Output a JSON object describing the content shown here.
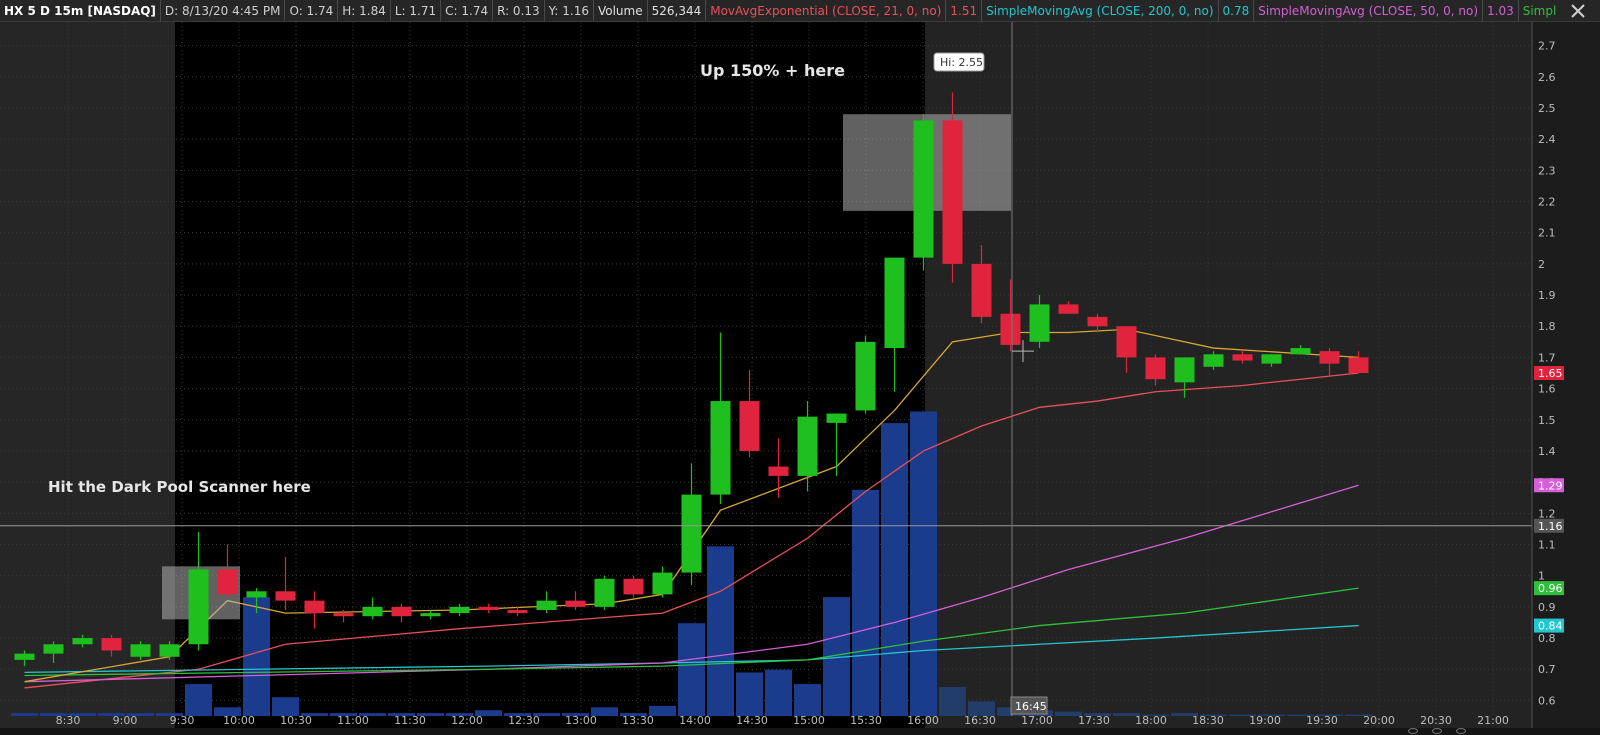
{
  "header": {
    "symbol": "HX 5 D 15m [NASDAQ]",
    "date": "D: 8/13/20 4:45 PM",
    "open": "O: 1.74",
    "high": "H: 1.84",
    "low": "L: 1.71",
    "close": "C: 1.74",
    "range": "R: 0.13",
    "y": "Y: 1.16",
    "volume_label": "Volume",
    "volume_value": "526,344",
    "studies": [
      {
        "label": "MovAvgExponential (CLOSE, 21, 0, no)",
        "value": "1.51",
        "color": "#e8505a"
      },
      {
        "label": "SimpleMovingAvg (CLOSE, 200, 0, no)",
        "value": "0.78",
        "color": "#22c6cf"
      },
      {
        "label": "SimpleMovingAvg (CLOSE, 50, 0, no)",
        "value": "1.03",
        "color": "#d45fd6"
      },
      {
        "label": "SimpleMovingAvg (CLOSE,...",
        "value": "",
        "color": "#2fbf3c"
      }
    ]
  },
  "annotations": {
    "up_text": "Up  150% + here",
    "scanner_text": "Hit the Dark Pool Scanner here",
    "hi_bubble": "Hi: 2.55",
    "crosshair_time": "16:45"
  },
  "chart_data": {
    "type": "candlestick",
    "interval": "15m",
    "ylim": [
      0.55,
      2.75
    ],
    "yticks": [
      0.6,
      0.7,
      0.8,
      0.9,
      1.0,
      1.1,
      1.2,
      1.3,
      1.4,
      1.5,
      1.6,
      1.7,
      1.8,
      1.9,
      2.0,
      2.1,
      2.2,
      2.3,
      2.4,
      2.5,
      2.6,
      2.7
    ],
    "ytick_labels": [
      "0.6",
      "0.7",
      "0.8",
      "0.9",
      "1",
      "1.1",
      "1.2",
      "1.3",
      "1.4",
      "1.5",
      "1.6",
      "1.7",
      "1.8",
      "1.9",
      "2",
      "2.1",
      "2.2",
      "2.3",
      "2.4",
      "2.5",
      "2.6",
      "2.7"
    ],
    "xticks": [
      "8:30",
      "9:00",
      "9:30",
      "10:00",
      "10:30",
      "11:00",
      "11:30",
      "12:00",
      "12:30",
      "13:00",
      "13:30",
      "14:00",
      "14:30",
      "15:00",
      "15:30",
      "16:00",
      "16:30",
      "17:00",
      "17:30",
      "18:00",
      "18:30",
      "19:00",
      "19:30",
      "20:00",
      "20:30",
      "21:00"
    ],
    "candles": [
      {
        "t": "8:15",
        "o": 0.73,
        "h": 0.76,
        "l": 0.71,
        "c": 0.75
      },
      {
        "t": "8:30",
        "o": 0.75,
        "h": 0.79,
        "l": 0.72,
        "c": 0.78
      },
      {
        "t": "8:45",
        "o": 0.78,
        "h": 0.81,
        "l": 0.77,
        "c": 0.8
      },
      {
        "t": "9:00",
        "o": 0.8,
        "h": 0.81,
        "l": 0.74,
        "c": 0.76
      },
      {
        "t": "9:15",
        "o": 0.74,
        "h": 0.79,
        "l": 0.73,
        "c": 0.78
      },
      {
        "t": "9:30",
        "o": 0.74,
        "h": 0.79,
        "l": 0.73,
        "c": 0.78
      },
      {
        "t": "9:45",
        "o": 0.78,
        "h": 1.14,
        "l": 0.76,
        "c": 1.02
      },
      {
        "t": "10:00",
        "o": 1.02,
        "h": 1.1,
        "l": 0.93,
        "c": 0.94
      },
      {
        "t": "10:15",
        "o": 0.93,
        "h": 0.96,
        "l": 0.88,
        "c": 0.95
      },
      {
        "t": "10:30",
        "o": 0.95,
        "h": 1.06,
        "l": 0.89,
        "c": 0.92
      },
      {
        "t": "10:45",
        "o": 0.92,
        "h": 0.95,
        "l": 0.83,
        "c": 0.88
      },
      {
        "t": "11:00",
        "o": 0.88,
        "h": 0.89,
        "l": 0.85,
        "c": 0.87
      },
      {
        "t": "11:15",
        "o": 0.87,
        "h": 0.93,
        "l": 0.86,
        "c": 0.9
      },
      {
        "t": "11:30",
        "o": 0.9,
        "h": 0.91,
        "l": 0.85,
        "c": 0.87
      },
      {
        "t": "11:45",
        "o": 0.87,
        "h": 0.89,
        "l": 0.86,
        "c": 0.88
      },
      {
        "t": "12:00",
        "o": 0.88,
        "h": 0.91,
        "l": 0.87,
        "c": 0.9
      },
      {
        "t": "12:15",
        "o": 0.9,
        "h": 0.91,
        "l": 0.88,
        "c": 0.89
      },
      {
        "t": "12:30",
        "o": 0.89,
        "h": 0.9,
        "l": 0.87,
        "c": 0.88
      },
      {
        "t": "12:45",
        "o": 0.89,
        "h": 0.95,
        "l": 0.88,
        "c": 0.92
      },
      {
        "t": "13:00",
        "o": 0.92,
        "h": 0.95,
        "l": 0.89,
        "c": 0.9
      },
      {
        "t": "13:15",
        "o": 0.9,
        "h": 1.0,
        "l": 0.89,
        "c": 0.99
      },
      {
        "t": "13:30",
        "o": 0.99,
        "h": 1.0,
        "l": 0.93,
        "c": 0.94
      },
      {
        "t": "13:45",
        "o": 0.94,
        "h": 1.03,
        "l": 0.93,
        "c": 1.01
      },
      {
        "t": "14:00",
        "o": 1.01,
        "h": 1.36,
        "l": 0.97,
        "c": 1.26
      },
      {
        "t": "14:15",
        "o": 1.26,
        "h": 1.78,
        "l": 1.23,
        "c": 1.56
      },
      {
        "t": "14:30",
        "o": 1.56,
        "h": 1.66,
        "l": 1.38,
        "c": 1.4
      },
      {
        "t": "14:45",
        "o": 1.35,
        "h": 1.44,
        "l": 1.25,
        "c": 1.32
      },
      {
        "t": "15:00",
        "o": 1.32,
        "h": 1.56,
        "l": 1.27,
        "c": 1.51
      },
      {
        "t": "15:15",
        "o": 1.49,
        "h": 1.52,
        "l": 1.32,
        "c": 1.52
      },
      {
        "t": "15:30",
        "o": 1.53,
        "h": 1.77,
        "l": 1.52,
        "c": 1.75
      },
      {
        "t": "15:45",
        "o": 1.73,
        "h": 1.92,
        "l": 1.59,
        "c": 2.02
      },
      {
        "t": "16:00",
        "o": 2.02,
        "h": 2.48,
        "l": 1.98,
        "c": 2.46
      },
      {
        "t": "16:15",
        "o": 2.46,
        "h": 2.55,
        "l": 1.94,
        "c": 2.0
      },
      {
        "t": "16:30",
        "o": 2.0,
        "h": 2.06,
        "l": 1.81,
        "c": 1.83
      },
      {
        "t": "16:45",
        "o": 1.84,
        "h": 1.95,
        "l": 1.72,
        "c": 1.74
      },
      {
        "t": "17:15",
        "o": 1.75,
        "h": 1.9,
        "l": 1.73,
        "c": 1.87
      },
      {
        "t": "17:30",
        "o": 1.87,
        "h": 1.88,
        "l": 1.84,
        "c": 1.84
      },
      {
        "t": "17:45",
        "o": 1.83,
        "h": 1.84,
        "l": 1.78,
        "c": 1.8
      },
      {
        "t": "18:00",
        "o": 1.8,
        "h": 1.8,
        "l": 1.65,
        "c": 1.7
      },
      {
        "t": "18:15",
        "o": 1.7,
        "h": 1.71,
        "l": 1.61,
        "c": 1.63
      },
      {
        "t": "18:30",
        "o": 1.62,
        "h": 1.7,
        "l": 1.57,
        "c": 1.7
      },
      {
        "t": "18:45",
        "o": 1.67,
        "h": 1.72,
        "l": 1.66,
        "c": 1.71
      },
      {
        "t": "19:00",
        "o": 1.71,
        "h": 1.72,
        "l": 1.68,
        "c": 1.69
      },
      {
        "t": "19:15",
        "o": 1.68,
        "h": 1.71,
        "l": 1.67,
        "c": 1.71
      },
      {
        "t": "19:30",
        "o": 1.71,
        "h": 1.74,
        "l": 1.71,
        "c": 1.73
      },
      {
        "t": "19:45",
        "o": 1.72,
        "h": 1.73,
        "l": 1.64,
        "c": 1.68
      },
      {
        "t": "20:00",
        "o": 1.7,
        "h": 1.72,
        "l": 1.65,
        "c": 1.65
      }
    ],
    "volume_heights": [
      0.02,
      0.02,
      0.02,
      0.02,
      0.02,
      0.02,
      0.22,
      0.06,
      0.82,
      0.13,
      0.02,
      0.02,
      0.02,
      0.02,
      0.02,
      0.02,
      0.04,
      0.02,
      0.02,
      0.02,
      0.06,
      0.02,
      0.07,
      0.64,
      1.17,
      0.3,
      0.32,
      0.22,
      0.82,
      1.56,
      2.02,
      2.1,
      0.2,
      0.1,
      0.06,
      0.04,
      0.03,
      0.02,
      0.02,
      0.01,
      0.02,
      0.01,
      0.01,
      0.01,
      0.01,
      0.01,
      0.01
    ],
    "series": [
      {
        "name": "MovAvgExponential (CLOSE, 21, 0, no)",
        "color": "#e8505a",
        "points": [
          [
            0,
            0.64
          ],
          [
            6,
            0.7
          ],
          [
            9,
            0.78
          ],
          [
            15,
            0.83
          ],
          [
            22,
            0.88
          ],
          [
            24,
            0.95
          ],
          [
            27,
            1.12
          ],
          [
            29,
            1.27
          ],
          [
            31,
            1.4
          ],
          [
            33,
            1.48
          ],
          [
            35,
            1.54
          ],
          [
            37,
            1.56
          ],
          [
            39,
            1.59
          ],
          [
            42,
            1.61
          ],
          [
            46,
            1.65
          ]
        ]
      },
      {
        "name": "SimpleMovingAvg (CLOSE, 200, 0, no)",
        "color": "#22c6cf",
        "points": [
          [
            0,
            0.69
          ],
          [
            8,
            0.7
          ],
          [
            16,
            0.71
          ],
          [
            22,
            0.72
          ],
          [
            27,
            0.73
          ],
          [
            31,
            0.76
          ],
          [
            35,
            0.78
          ],
          [
            39,
            0.8
          ],
          [
            46,
            0.84
          ]
        ]
      },
      {
        "name": "SimpleMovingAvg (CLOSE, 50, 0, no)",
        "color": "#d45fd6",
        "points": [
          [
            0,
            0.66
          ],
          [
            8,
            0.68
          ],
          [
            16,
            0.7
          ],
          [
            22,
            0.72
          ],
          [
            27,
            0.78
          ],
          [
            30,
            0.85
          ],
          [
            33,
            0.93
          ],
          [
            36,
            1.02
          ],
          [
            40,
            1.12
          ],
          [
            46,
            1.29
          ]
        ]
      },
      {
        "name": "SimpleMovingAvg (CLOSE,...",
        "color": "#2fbf3c",
        "points": [
          [
            0,
            0.68
          ],
          [
            8,
            0.69
          ],
          [
            16,
            0.7
          ],
          [
            22,
            0.71
          ],
          [
            27,
            0.73
          ],
          [
            31,
            0.79
          ],
          [
            35,
            0.84
          ],
          [
            40,
            0.88
          ],
          [
            46,
            0.96
          ]
        ]
      },
      {
        "name": "yellow-ma",
        "color": "#d8a634",
        "points": [
          [
            0,
            0.66
          ],
          [
            5,
            0.74
          ],
          [
            7,
            0.92
          ],
          [
            9,
            0.88
          ],
          [
            15,
            0.89
          ],
          [
            20,
            0.91
          ],
          [
            22,
            0.94
          ],
          [
            24,
            1.21
          ],
          [
            28,
            1.35
          ],
          [
            30,
            1.53
          ],
          [
            32,
            1.75
          ],
          [
            34,
            1.78
          ],
          [
            36,
            1.78
          ],
          [
            38,
            1.79
          ],
          [
            41,
            1.73
          ],
          [
            46,
            1.7
          ]
        ]
      }
    ],
    "price_labels": [
      {
        "value": 1.65,
        "text": "1.65",
        "color": "#e0243e"
      },
      {
        "value": 1.29,
        "text": "1.29",
        "color": "#d45fd6"
      },
      {
        "value": 1.16,
        "text": "1.16",
        "color": "#555555"
      },
      {
        "value": 0.96,
        "text": "0.96",
        "color": "#2fbf3c"
      },
      {
        "value": 0.84,
        "text": "0.84",
        "color": "#22c6cf"
      }
    ],
    "grid": true,
    "horizontal_line": 1.16,
    "colors": {
      "up": "#1fbf1f",
      "down": "#e0243e",
      "volume": "#1b3b8c"
    }
  }
}
